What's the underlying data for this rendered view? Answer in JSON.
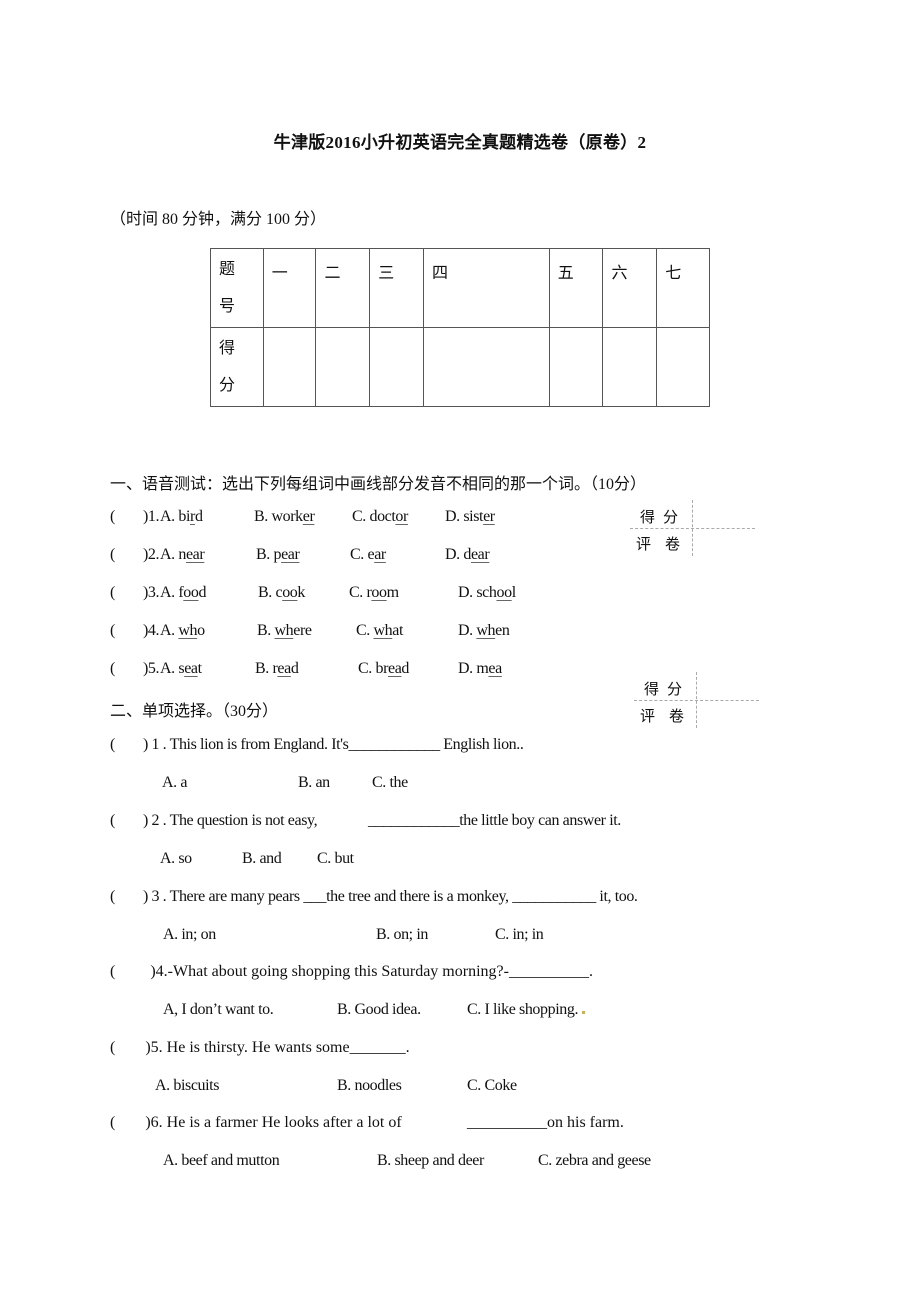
{
  "document": {
    "title": "牛津版2016小升初英语完全真题精选卷（原卷）2",
    "subtitle": "（时间 80 分钟，满分 100 分）"
  },
  "score_table": {
    "row1_label": [
      "题",
      "号"
    ],
    "columns": [
      "一",
      "二",
      "三",
      "四",
      "五",
      "六",
      "七"
    ],
    "row2_label": [
      "得",
      "分"
    ]
  },
  "grader_box": {
    "line1": "得分",
    "line2": "评卷"
  },
  "section1": {
    "heading": "一、语音测试：选出下列每组词中画线部分发音不相同的那一个词。（10分）",
    "questions": [
      {
        "num": ")1. ",
        "options": [
          {
            "prefix": "A. bi",
            "u": "r",
            "suffix": "d"
          },
          {
            "prefix": "B. work",
            "u": "er",
            "suffix": ""
          },
          {
            "prefix": "C. doct",
            "u": "or",
            "suffix": ""
          },
          {
            "prefix": "D. sist",
            "u": "er",
            "suffix": ""
          }
        ]
      },
      {
        "num": ")2. ",
        "options": [
          {
            "prefix": "A. n",
            "u": "ear",
            "suffix": ""
          },
          {
            "prefix": "B. p",
            "u": "ear",
            "suffix": ""
          },
          {
            "prefix": "C. e",
            "u": "ar",
            "suffix": ""
          },
          {
            "prefix": "D. d",
            "u": "ear",
            "suffix": ""
          }
        ]
      },
      {
        "num": ")3. ",
        "options": [
          {
            "prefix": "A. f",
            "u": "oo",
            "suffix": "d"
          },
          {
            "prefix": "B. c",
            "u": "oo",
            "suffix": "k"
          },
          {
            "prefix": "C. r",
            "u": "oo",
            "suffix": "m"
          },
          {
            "prefix": "D. sch",
            "u": "oo",
            "suffix": "l"
          }
        ]
      },
      {
        "num": ")4. ",
        "options": [
          {
            "prefix": "A. ",
            "u": "wh",
            "suffix": "o"
          },
          {
            "prefix": "B. ",
            "u": "wh",
            "suffix": "ere"
          },
          {
            "prefix": "C. ",
            "u": "wh",
            "suffix": "at"
          },
          {
            "prefix": "D. ",
            "u": "wh",
            "suffix": "en"
          }
        ]
      },
      {
        "num": ")5. ",
        "options": [
          {
            "prefix": "A. s",
            "u": "ea",
            "suffix": "t"
          },
          {
            "prefix": "B. r",
            "u": "ea",
            "suffix": "d"
          },
          {
            "prefix": "C. br",
            "u": "ea",
            "suffix": "d"
          },
          {
            "prefix": "D. m",
            "u": "ea",
            "suffix": ""
          }
        ]
      }
    ]
  },
  "section2": {
    "heading": "二、单项选择。（30分）",
    "questions": [
      {
        "stem": ") 1 .  This lion is from England. It's____________ English lion..",
        "options": [
          "A. a",
          "B. an",
          "C. the"
        ]
      },
      {
        "stem": ") 2 .  The question is not easy,",
        "stem2": "____________the little boy can answer it.",
        "options": [
          "A. so",
          "B. and",
          "C. but"
        ]
      },
      {
        "stem": ") 3 .  There are many pears ___the tree and there is a monkey, ___________ it, too.",
        "options": [
          "A. in; on",
          "B. on; in",
          "C.  in; in"
        ]
      },
      {
        "stem": ")4.-What about going shopping this Saturday morning?-__________.",
        "options": [
          "A, I don’t want to.",
          "B. Good idea.",
          "C. I like shopping."
        ]
      },
      {
        "stem": ")5. He is thirsty. He wants some_______.",
        "options": [
          "A. biscuits",
          "B. noodles",
          "C. Coke"
        ]
      },
      {
        "stem": ")6. He is a farmer He looks after a lot of",
        "stem2": "__________on his farm.",
        "options": [
          "A. beef and mutton",
          "B. sheep and deer",
          "C. zebra and geese"
        ]
      }
    ]
  },
  "answer_paren": "("
}
